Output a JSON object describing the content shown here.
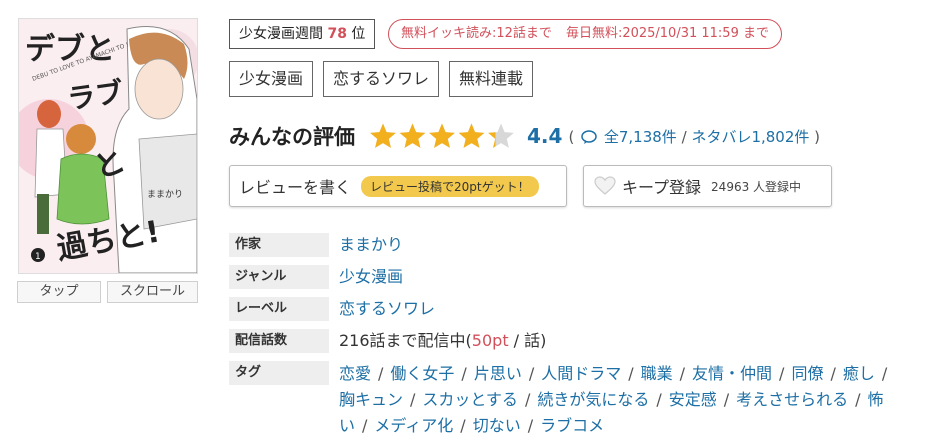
{
  "cover": {
    "title_text": "デブとラブと過ちと!",
    "subtitle_text": "DEBU TO LOVE TO AYAMACHI TO !",
    "author_text": "ままかり",
    "volume_text": "1"
  },
  "view_buttons": {
    "tap": "タップ",
    "scroll": "スクロール"
  },
  "rank": {
    "prefix": "少女漫画週間",
    "number": "78",
    "suffix": "位"
  },
  "free": {
    "part1": "無料イッキ読み:12話まで",
    "part2": "毎日無料:2025/10/31 11:59 まで"
  },
  "categories": [
    "少女漫画",
    "恋するソワレ",
    "無料連載"
  ],
  "rating": {
    "title": "みんなの評価",
    "score": "4.4",
    "value": 4.4,
    "paren_open": "(",
    "total": "全7,138件",
    "slash": "/",
    "spoilers": "ネタバレ1,802件",
    "paren_close": ")"
  },
  "review": {
    "label": "レビューを書く",
    "bonus": "レビュー投稿で20ptゲット！"
  },
  "keep": {
    "label": "キープ登録",
    "count": "24963 人登録中"
  },
  "info": {
    "author_key": "作家",
    "author": "ままかり",
    "genre_key": "ジャンル",
    "genre": "少女漫画",
    "label_key": "レーベル",
    "label": "恋するソワレ",
    "episodes_key": "配信話数",
    "episodes_prefix": "216話まで配信中(",
    "episodes_pt": "50pt",
    "episodes_suffix": " / 話)",
    "tags_key": "タグ"
  },
  "tags": [
    "恋愛",
    "働く女子",
    "片思い",
    "人間ドラマ",
    "職業",
    "友情・仲間",
    "同僚",
    "癒し",
    "胸キュン",
    "スカッとする",
    "続きが気になる",
    "安定感",
    "考えさせられる",
    "怖い",
    "メディア化",
    "切ない",
    "ラブコメ"
  ],
  "colors": {
    "accent": "#d1505a",
    "link": "#1d6fa5",
    "star": "#f2b01e",
    "pill": "#f2c94c"
  }
}
